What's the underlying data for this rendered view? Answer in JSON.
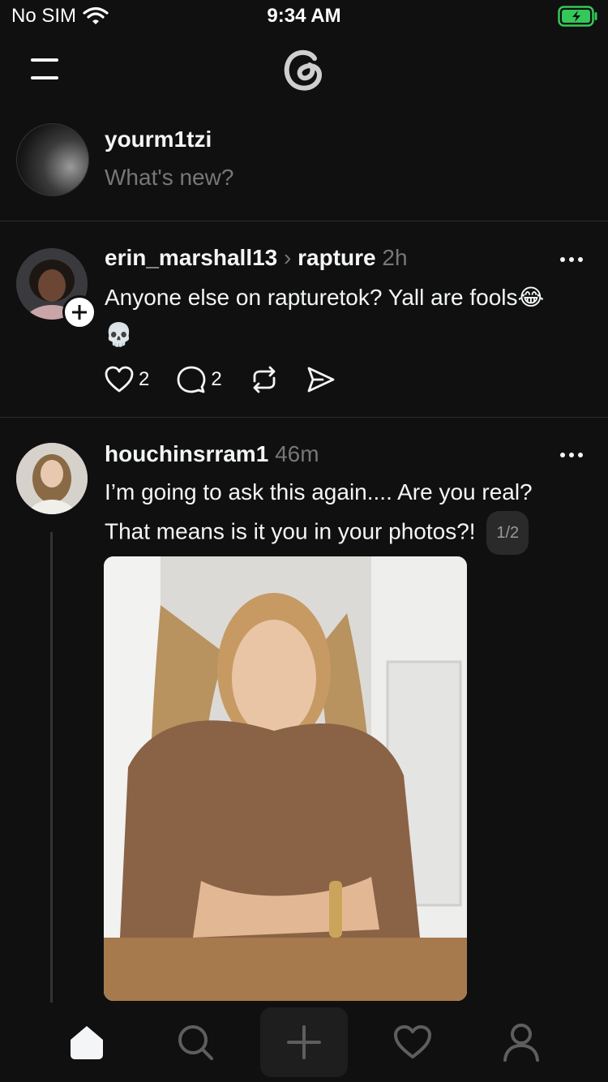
{
  "status_bar": {
    "carrier": "No SIM",
    "time": "9:34 AM"
  },
  "composer": {
    "username": "yourm1tzi",
    "placeholder": "What's new?"
  },
  "posts": [
    {
      "username": "erin_marshall13",
      "community": "rapture",
      "time": "2h",
      "text_line1": "Anyone else on rapturetok? Yall are fools😂",
      "text_line2": "💀",
      "likes": "2",
      "replies": "2"
    },
    {
      "username": "houchinsrram1",
      "time": "46m",
      "text_line1": "I’m going to ask this again.... Are you real?",
      "text_line2": "That means is it you in your photos?!",
      "image_counter": "1/2"
    }
  ],
  "icons": {
    "header": [
      "menu-icon",
      "threads-logo-icon"
    ],
    "actions": [
      "heart-icon",
      "comment-icon",
      "repost-icon",
      "share-icon"
    ],
    "nav": [
      "home-icon",
      "search-icon",
      "plus-icon",
      "heart-icon",
      "profile-icon"
    ]
  },
  "colors": {
    "background": "#101010",
    "text": "#f3f5f7",
    "muted": "#777777",
    "battery": "#34c759"
  }
}
